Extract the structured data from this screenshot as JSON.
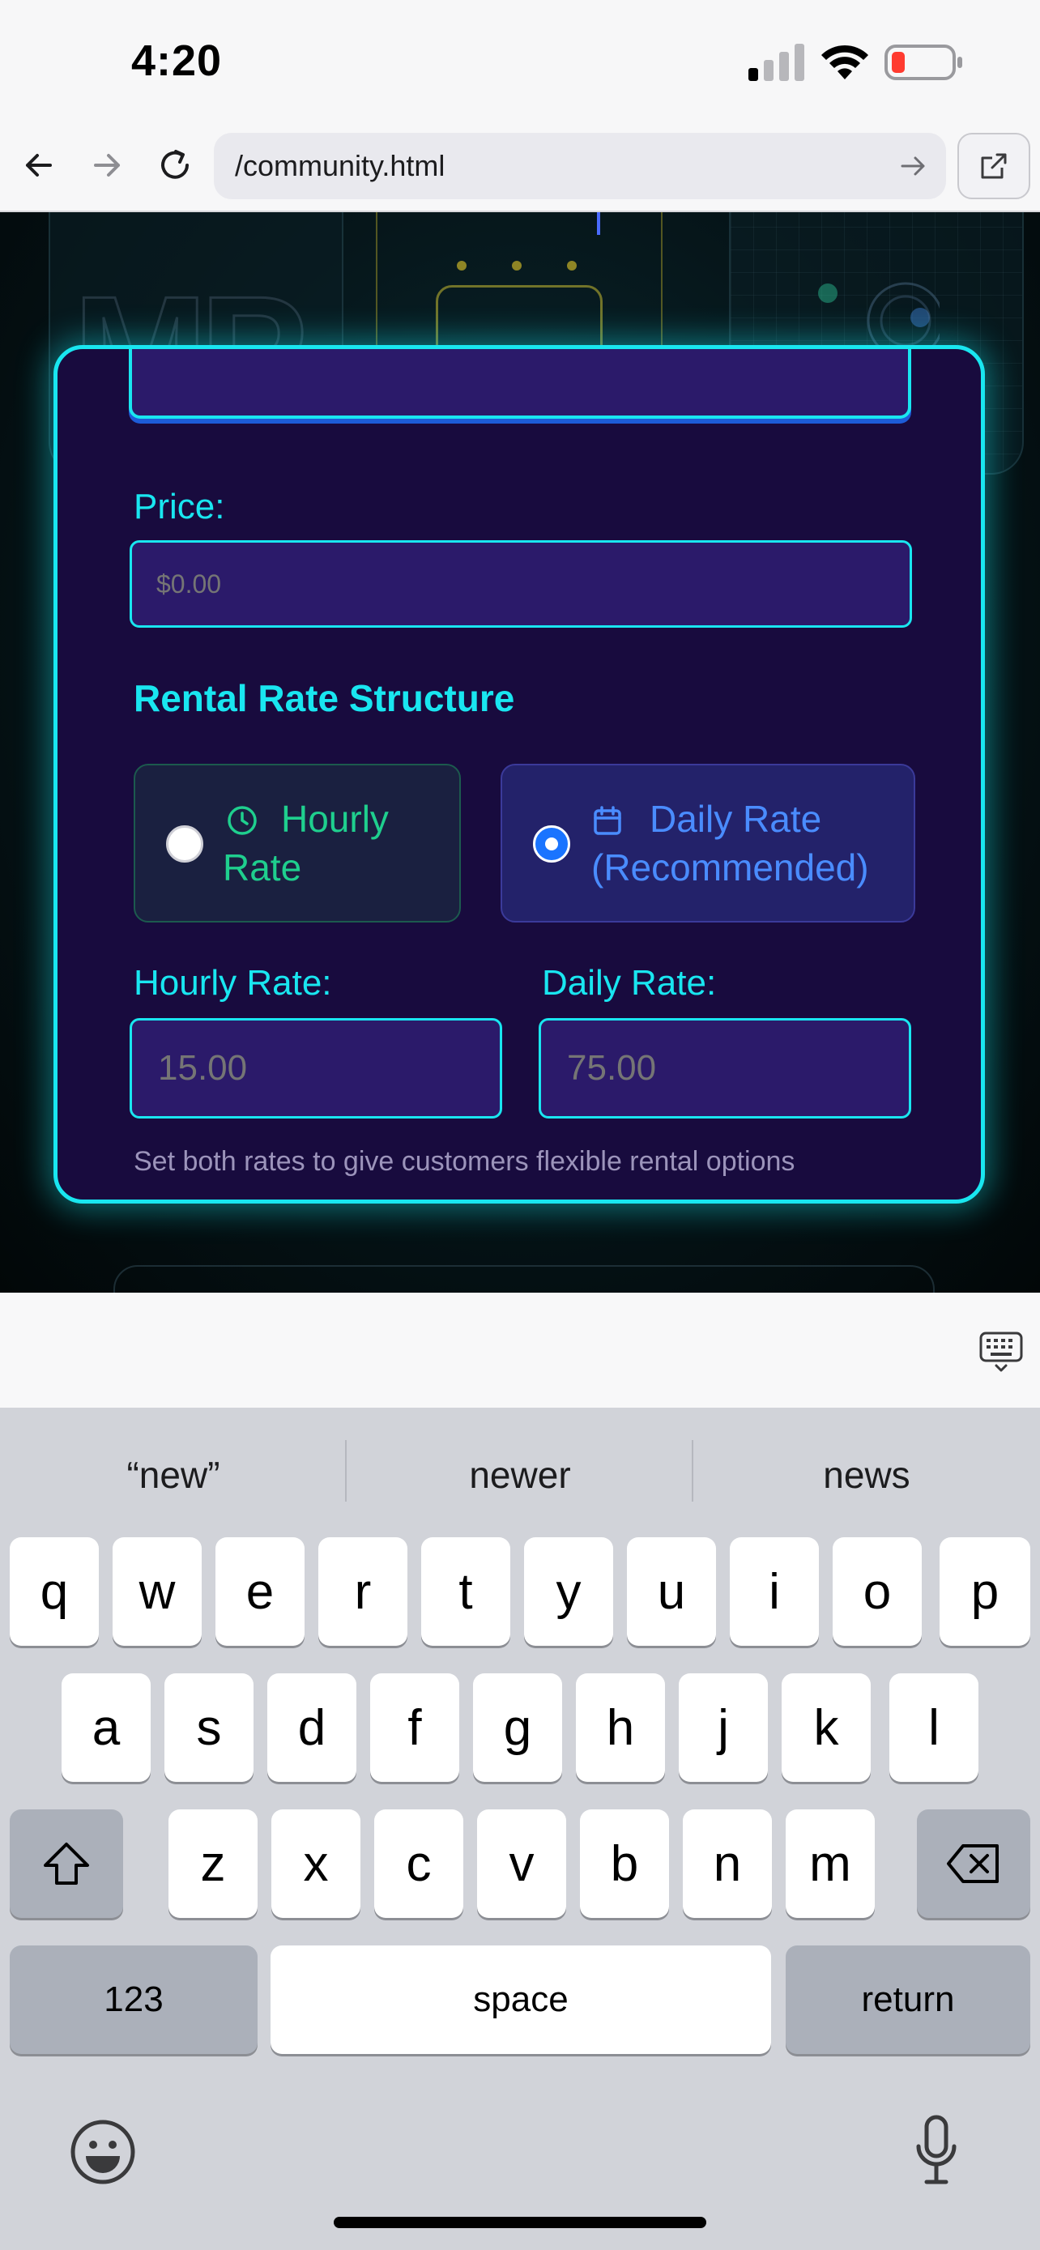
{
  "status_bar": {
    "time": "4:20"
  },
  "browser": {
    "url": "/community.html"
  },
  "form": {
    "price_label": "Price:",
    "price_placeholder": "$0.00",
    "section_title": "Rental Rate Structure",
    "options": [
      {
        "label_line1": "Hourly",
        "label_line2": "Rate",
        "selected": false,
        "icon": "clock-icon"
      },
      {
        "label_line1": "Daily Rate",
        "label_line2": "(Recommended)",
        "selected": true,
        "icon": "calendar-icon"
      }
    ],
    "hourly_label": "Hourly Rate:",
    "hourly_placeholder": "15.00",
    "daily_label": "Daily Rate:",
    "daily_placeholder": "75.00",
    "helper_text": "Set both rates to give customers flexible rental options"
  },
  "keyboard": {
    "suggestions": [
      "“new”",
      "newer",
      "news"
    ],
    "row1": [
      "q",
      "w",
      "e",
      "r",
      "t",
      "y",
      "u",
      "i",
      "o",
      "p"
    ],
    "row2": [
      "a",
      "s",
      "d",
      "f",
      "g",
      "h",
      "j",
      "k",
      "l"
    ],
    "row3": [
      "z",
      "x",
      "c",
      "v",
      "b",
      "n",
      "m"
    ],
    "numbers_key": "123",
    "space_key": "space",
    "return_key": "return"
  },
  "colors": {
    "accent": "#19e6f0",
    "modal_bg": "#180b3e",
    "input_bg": "#2b1a6a",
    "hourly": "#1fcf8e",
    "daily": "#4a8cff"
  }
}
